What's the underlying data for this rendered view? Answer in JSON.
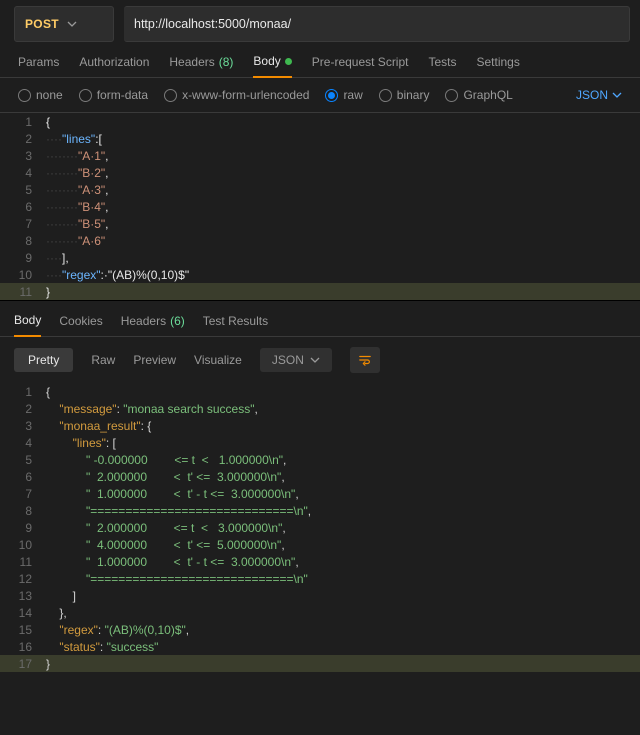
{
  "request": {
    "method": "POST",
    "url": "http://localhost:5000/monaa/",
    "tabs": {
      "params": "Params",
      "authorization": "Authorization",
      "headers": "Headers",
      "headers_count": "(8)",
      "body": "Body",
      "prerequest": "Pre-request Script",
      "tests": "Tests",
      "settings": "Settings"
    },
    "body_types": {
      "none": "none",
      "formdata": "form-data",
      "xform": "x-www-form-urlencoded",
      "raw": "raw",
      "binary": "binary",
      "graphql": "GraphQL"
    },
    "lang_label": "JSON"
  },
  "request_body": {
    "lines": [
      {
        "n": "1",
        "indent": "",
        "t": "{"
      },
      {
        "n": "2",
        "indent": "····",
        "t": "\"lines\":["
      },
      {
        "n": "3",
        "indent": "········",
        "t": "\"A·1\","
      },
      {
        "n": "4",
        "indent": "········",
        "t": "\"B·2\","
      },
      {
        "n": "5",
        "indent": "········",
        "t": "\"A·3\","
      },
      {
        "n": "6",
        "indent": "········",
        "t": "\"B·4\","
      },
      {
        "n": "7",
        "indent": "········",
        "t": "\"B·5\","
      },
      {
        "n": "8",
        "indent": "········",
        "t": "\"A·6\""
      },
      {
        "n": "9",
        "indent": "····",
        "t": "],"
      },
      {
        "n": "10",
        "indent": "····",
        "t": "\"regex\":·\"(AB)%(0,10)$\""
      },
      {
        "n": "11",
        "indent": "",
        "t": "}",
        "hl": true
      }
    ]
  },
  "response": {
    "tabs": {
      "body": "Body",
      "cookies": "Cookies",
      "headers": "Headers",
      "headers_count": "(6)",
      "testresults": "Test Results"
    },
    "views": {
      "pretty": "Pretty",
      "raw": "Raw",
      "preview": "Preview",
      "visualize": "Visualize"
    },
    "format_label": "JSON"
  },
  "response_body": {
    "lines": [
      {
        "n": "1",
        "i": 0,
        "raw": "{"
      },
      {
        "n": "2",
        "i": 1,
        "raw": "\"message\": \"monaa search success\","
      },
      {
        "n": "3",
        "i": 1,
        "raw": "\"monaa_result\": {"
      },
      {
        "n": "4",
        "i": 2,
        "raw": "\"lines\": ["
      },
      {
        "n": "5",
        "i": 3,
        "raw": "\" -0.000000        <= t  <   1.000000\\n\","
      },
      {
        "n": "6",
        "i": 3,
        "raw": "\"  2.000000        <  t' <=  3.000000\\n\","
      },
      {
        "n": "7",
        "i": 3,
        "raw": "\"  1.000000        <  t' - t <=  3.000000\\n\","
      },
      {
        "n": "8",
        "i": 3,
        "raw": "\"=============================\\n\","
      },
      {
        "n": "9",
        "i": 3,
        "raw": "\"  2.000000        <= t  <   3.000000\\n\","
      },
      {
        "n": "10",
        "i": 3,
        "raw": "\"  4.000000        <  t' <=  5.000000\\n\","
      },
      {
        "n": "11",
        "i": 3,
        "raw": "\"  1.000000        <  t' - t <=  3.000000\\n\","
      },
      {
        "n": "12",
        "i": 3,
        "raw": "\"=============================\\n\""
      },
      {
        "n": "13",
        "i": 2,
        "raw": "]"
      },
      {
        "n": "14",
        "i": 1,
        "raw": "},"
      },
      {
        "n": "15",
        "i": 1,
        "raw": "\"regex\": \"(AB)%(0,10)$\","
      },
      {
        "n": "16",
        "i": 1,
        "raw": "\"status\": \"success\""
      },
      {
        "n": "17",
        "i": 0,
        "raw": "}",
        "hl": true
      }
    ]
  }
}
